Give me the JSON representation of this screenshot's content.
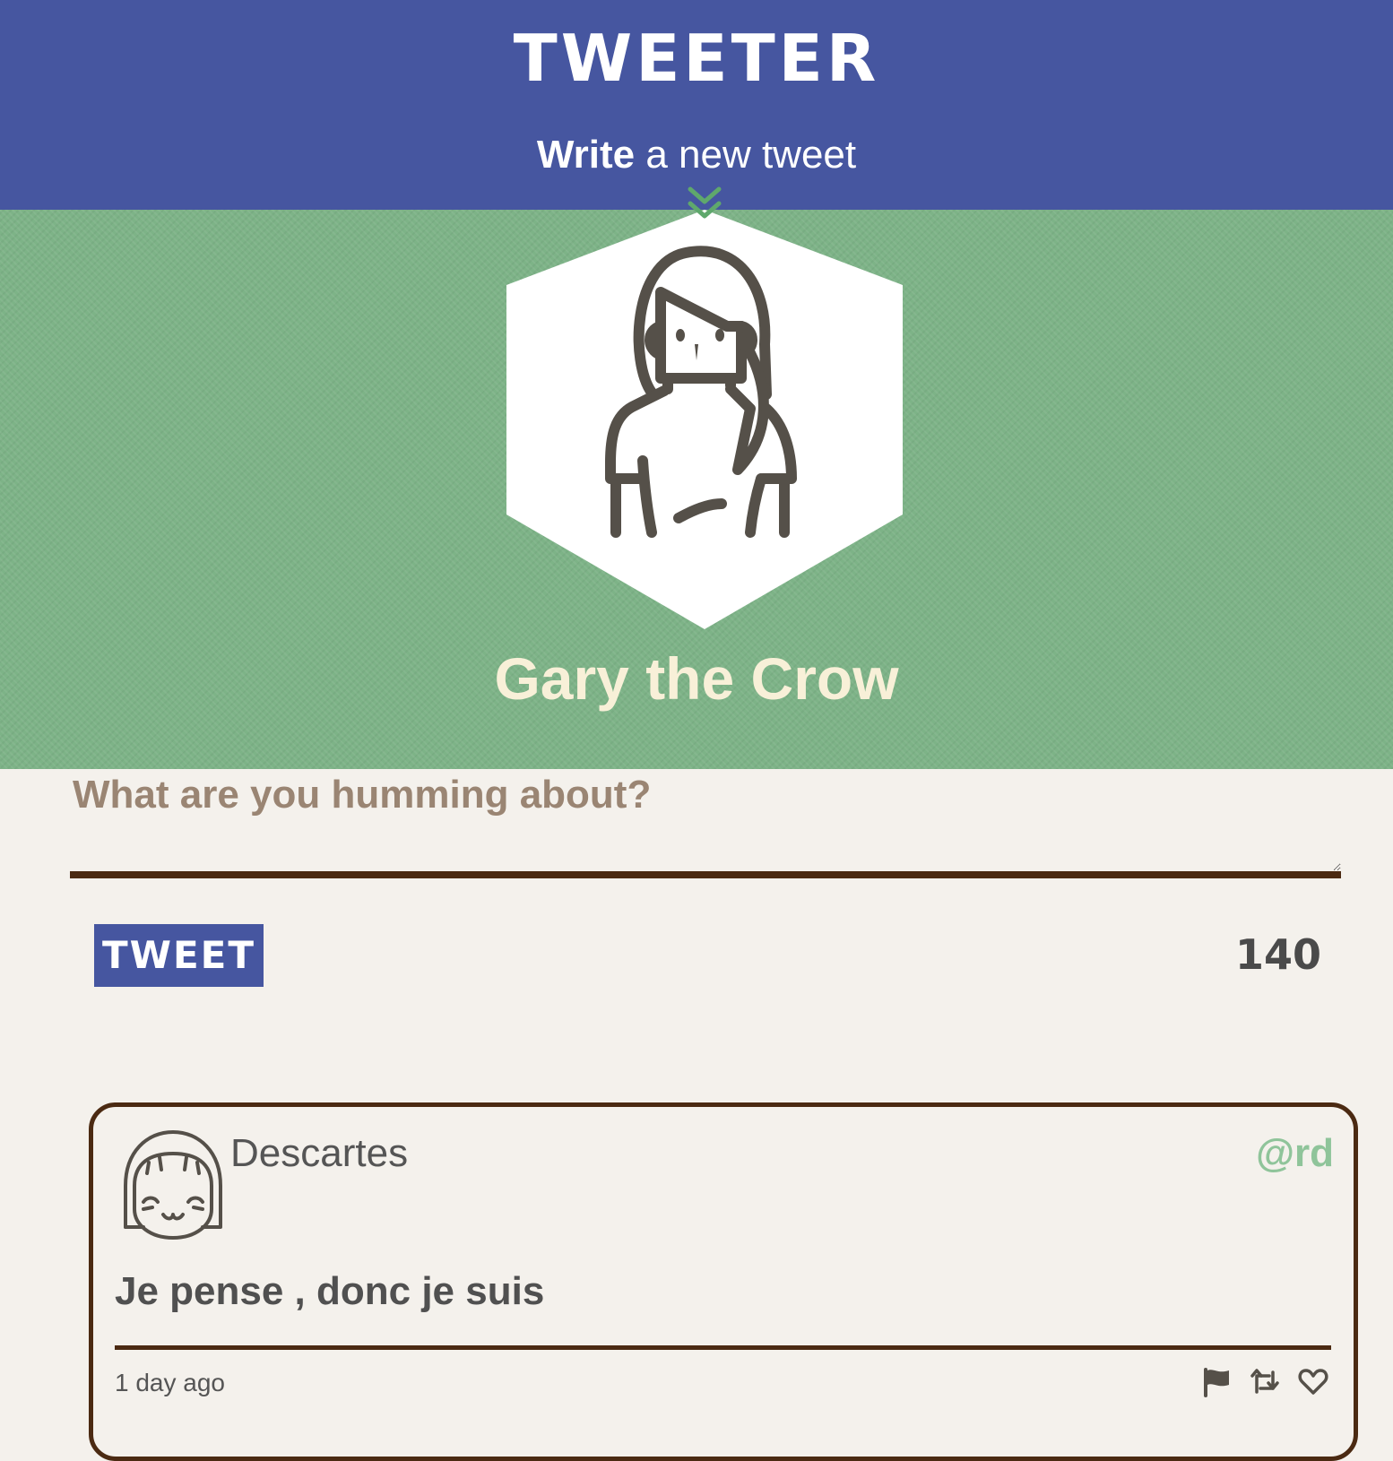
{
  "header": {
    "brand": "TWEETER",
    "compose_toggle": {
      "strong": "Write",
      "rest": " a new tweet",
      "icon": "double-chevron-down-icon"
    }
  },
  "profile": {
    "name": "Gary the Crow",
    "avatar_icon": "girl-avatar-icon"
  },
  "composer": {
    "placeholder": "What are you humming about?",
    "value": "",
    "button_label": "TWEET",
    "counter": "140"
  },
  "tweets": [
    {
      "author": "Descartes",
      "handle": "@rd",
      "avatar_icon": "smiling-face-avatar-icon",
      "text": "Je pense , donc je suis",
      "time": "1 day ago",
      "actions": [
        "flag-icon",
        "retweet-icon",
        "heart-icon"
      ]
    }
  ],
  "colors": {
    "header_bg": "#4656a0",
    "banner_bg": "#7db387",
    "page_bg": "#f4f1ec",
    "accent_brown": "#4b2a12",
    "name_color": "#f8f0d8",
    "handle_color": "#8fc49a"
  }
}
